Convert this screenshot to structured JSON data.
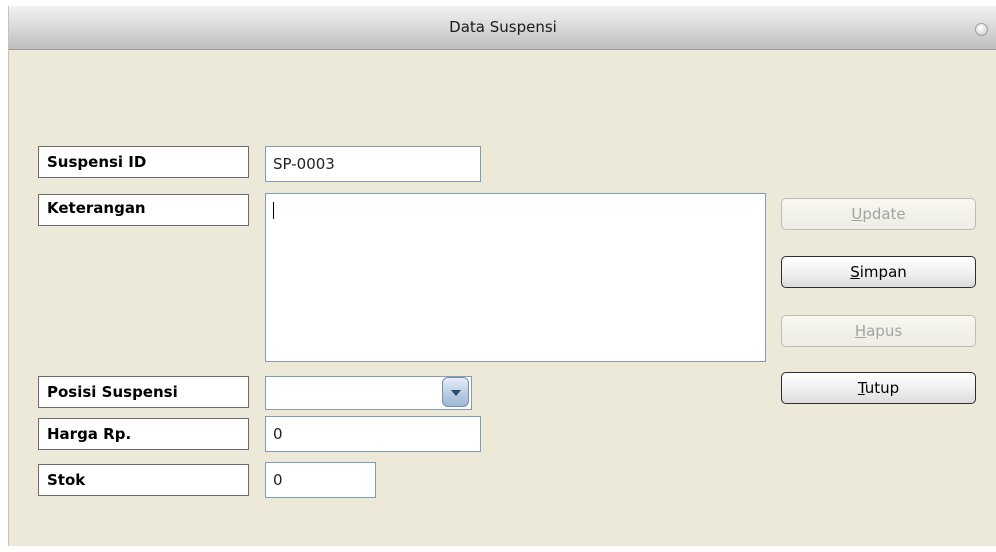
{
  "window": {
    "title": "Data Suspensi"
  },
  "form": {
    "suspensi_id": {
      "label": "Suspensi ID",
      "value": "SP-0003"
    },
    "keterangan": {
      "label": "Keterangan",
      "value": ""
    },
    "posisi_suspensi": {
      "label": "Posisi Suspensi",
      "value": ""
    },
    "harga": {
      "label": "Harga Rp.",
      "value": "0"
    },
    "stok": {
      "label": "Stok",
      "value": "0"
    }
  },
  "buttons": {
    "update": {
      "mnemonic": "U",
      "rest": "pdate",
      "enabled": false
    },
    "simpan": {
      "mnemonic": "S",
      "rest": "impan",
      "enabled": true
    },
    "hapus": {
      "mnemonic": "H",
      "rest": "apus",
      "enabled": false
    },
    "tutup": {
      "mnemonic": "T",
      "rest": "utup",
      "enabled": true
    }
  },
  "icons": {
    "close": "close-circle-icon",
    "dropdown": "chevron-down-icon"
  },
  "colors": {
    "window_bg": "#ece9d8",
    "disabled_text": "#a3a3a3",
    "field_border": "#7f9db9"
  }
}
